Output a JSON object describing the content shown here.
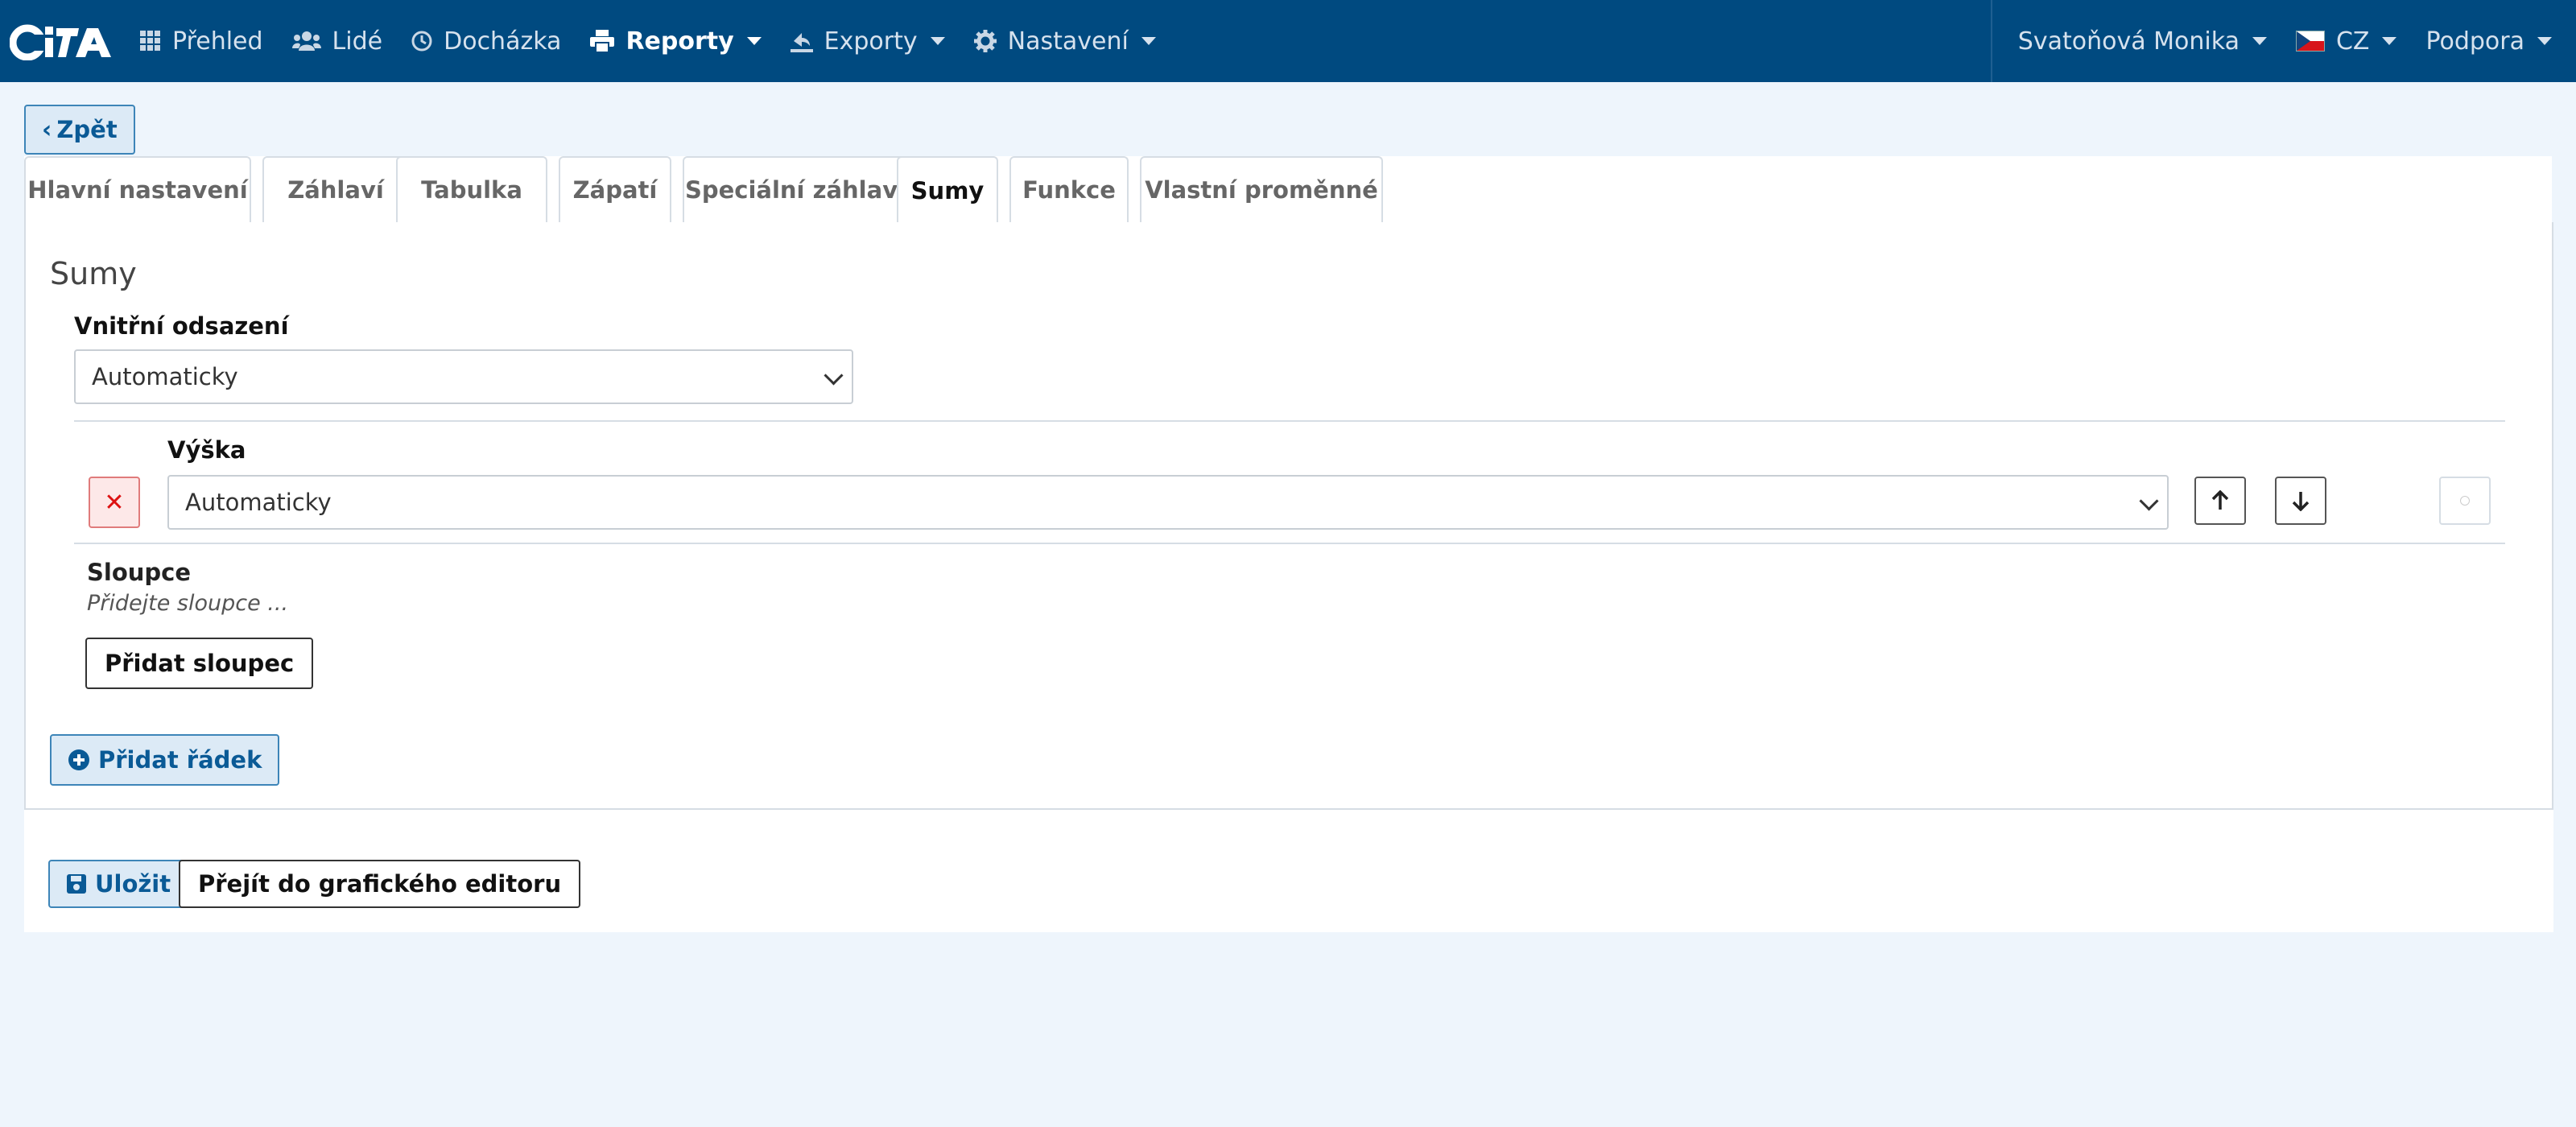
{
  "navbar": {
    "brand": "CITA",
    "items": [
      {
        "label": "Přehled",
        "icon": "grid-icon"
      },
      {
        "label": "Lidé",
        "icon": "users-icon"
      },
      {
        "label": "Docházka",
        "icon": "clock-icon"
      },
      {
        "label": "Reporty",
        "icon": "print-icon",
        "active": true
      },
      {
        "label": "Exporty",
        "icon": "export-icon"
      },
      {
        "label": "Nastavení",
        "icon": "gear-icon"
      }
    ],
    "user": "Svatoňová Monika",
    "language": "CZ",
    "support": "Podpora"
  },
  "back_label": "Zpět",
  "tabs": [
    {
      "label": "Hlavní nastavení"
    },
    {
      "label": "Záhlaví"
    },
    {
      "label": "Tabulka"
    },
    {
      "label": "Zápatí"
    },
    {
      "label": "Speciální záhlaví"
    },
    {
      "label": "Sumy",
      "active": true
    },
    {
      "label": "Funkce"
    },
    {
      "label": "Vlastní proměnné"
    }
  ],
  "section": {
    "title": "Sumy",
    "padding_label": "Vnitřní odsazení",
    "padding_value": "Automaticky",
    "row": {
      "height_label": "Výška",
      "height_value": "Automaticky",
      "columns_label": "Sloupce",
      "columns_placeholder": "Přidejte sloupce ...",
      "add_column_label": "Přidat sloupec"
    },
    "add_row_label": "Přidat řádek"
  },
  "footer": {
    "save_label": "Uložit",
    "editor_label": "Přejít do grafického editoru"
  },
  "colors": {
    "navbar": "#004a80",
    "accent": "#0a5a96",
    "background": "#eef5fc"
  }
}
